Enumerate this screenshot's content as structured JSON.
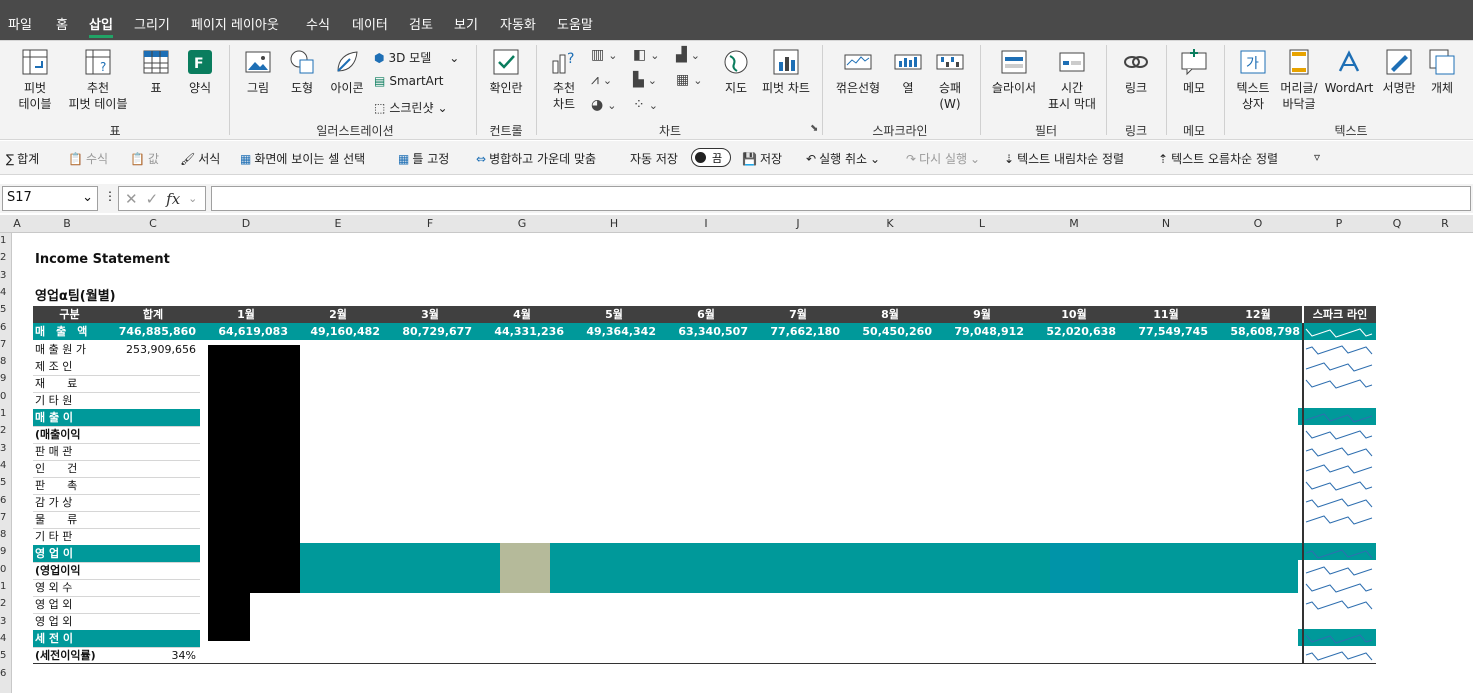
{
  "menu_tabs": [
    "파일",
    "홈",
    "삽입",
    "그리기",
    "페이지 레이아웃",
    "수식",
    "데이터",
    "검토",
    "보기",
    "자동화",
    "도움말"
  ],
  "active_tab": "삽입",
  "ribbon": {
    "pivot_table": "피벗\n테이블",
    "recommended_pivot": "추천\n피벗 테이블",
    "table": "표",
    "forms": "양식",
    "pictures": "그림",
    "shapes": "도형",
    "icons": "아이콘",
    "model_3d": "3D 모델",
    "smartart": "SmartArt",
    "screenshot": "스크린샷",
    "checkbox": "확인란",
    "recommended_charts": "추천\n차트",
    "maps": "지도",
    "pivot_chart": "피벗 차트",
    "spark_line": "꺾은선형",
    "spark_column": "열",
    "spark_winloss": "승패\n(W)",
    "slicer": "슬라이서",
    "timeline": "시간\n표시 막대",
    "link": "링크",
    "comment": "메모",
    "textbox": "텍스트\n상자",
    "header_footer": "머리글/\n바닥글",
    "wordart": "WordArt",
    "signature": "서명란",
    "object": "개체",
    "groups": {
      "tables": "표",
      "illustrations": "일러스트레이션",
      "controls": "컨트롤",
      "charts": "차트",
      "sparklines": "스파크라인",
      "filters": "필터",
      "links": "링크",
      "comments": "메모",
      "text": "텍스트"
    }
  },
  "qat": {
    "sum": "합계",
    "formula": "수식",
    "value": "값",
    "format": "서식",
    "select_visible": "화면에 보이는 셀 선택",
    "freeze": "틀 고정",
    "merge_center": "병합하고 가운데 맞춤",
    "autosave": "자동 저장",
    "autosave_state": "끔",
    "save": "저장",
    "undo": "실행 취소",
    "redo": "다시 실행",
    "sort_desc": "텍스트 내림차순 정렬",
    "sort_asc": "텍스트 오름차순 정렬"
  },
  "namebox": "S17",
  "columns": [
    "A",
    "B",
    "C",
    "D",
    "E",
    "F",
    "G",
    "H",
    "I",
    "J",
    "K",
    "L",
    "M",
    "N",
    "O",
    "P",
    "Q",
    "R"
  ],
  "sheet": {
    "title": "Income Statement",
    "subtitle": "영업α팀(월별)",
    "header": {
      "category": "구분",
      "total": "합계",
      "months": [
        "1월",
        "2월",
        "3월",
        "4월",
        "5월",
        "6월",
        "7월",
        "8월",
        "9월",
        "10월",
        "11월",
        "12월"
      ],
      "spark": "스파크 라인"
    },
    "sales": {
      "label": "매　출　액",
      "total": "746,885,860",
      "months": [
        "64,619,083",
        "49,160,482",
        "80,729,677",
        "44,331,236",
        "49,364,342",
        "63,340,507",
        "77,662,180",
        "50,450,260",
        "79,048,912",
        "52,020,638",
        "77,549,745",
        "58,608,798"
      ]
    },
    "cogs": {
      "label": "매 출 원 가",
      "total": "253,909,656"
    },
    "rows": [
      "제 조 인",
      "재　　료",
      "기 타 원",
      "매 출 이",
      "(매출이익",
      "판 매 관",
      "인　　건",
      "판　　촉",
      "감 가 상",
      "물　　류",
      "기 타 판",
      "영 업 이",
      "(영업이익",
      "영 외 수",
      "영 업 외",
      "영 업 외",
      "세 전 이"
    ],
    "pretax_rate": {
      "label": "(세전이익률)",
      "total": "34%"
    }
  },
  "colors": {
    "teal": "#00999a",
    "header": "#404040",
    "tabbar": "#4a4a4a"
  }
}
